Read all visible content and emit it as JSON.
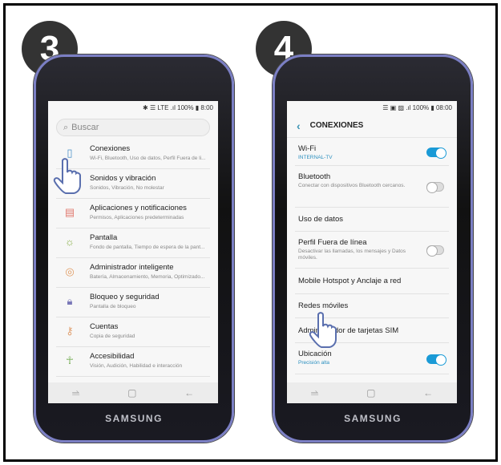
{
  "steps": [
    {
      "number": "3"
    },
    {
      "number": "4"
    }
  ],
  "brand": "SAMSUNG",
  "left": {
    "status": "✱ ☰ LTE .ıl 100% ▮ 8:00",
    "search_placeholder": "Buscar",
    "items": [
      {
        "title": "Conexiones",
        "subtitle": "Wi-Fi, Bluetooth, Uso de datos, Perfil Fuera de li...",
        "icon": "connections-icon",
        "color": "#4a90c8"
      },
      {
        "title": "Sonidos y vibración",
        "subtitle": "Sonidos, Vibración, No molestar",
        "icon": "sound-icon",
        "color": "#8a6fc8"
      },
      {
        "title": "Aplicaciones y notificaciones",
        "subtitle": "Permisos, Aplicaciones predeterminadas",
        "icon": "apps-icon",
        "color": "#e07a70"
      },
      {
        "title": "Pantalla",
        "subtitle": "Fondo de pantalla, Tiempo de espera de la pant...",
        "icon": "display-icon",
        "color": "#8ab04a"
      },
      {
        "title": "Administrador inteligente",
        "subtitle": "Batería, Almacenamiento, Memoria, Optimizado...",
        "icon": "device-care-icon",
        "color": "#e09a60"
      },
      {
        "title": "Bloqueo y seguridad",
        "subtitle": "Pantalla de bloqueo",
        "icon": "lock-icon",
        "color": "#7a78b8"
      },
      {
        "title": "Cuentas",
        "subtitle": "Copia de seguridad",
        "icon": "key-icon",
        "color": "#e0a070"
      },
      {
        "title": "Accesibilidad",
        "subtitle": "Visión, Audición, Habilidad e interacción",
        "icon": "accessibility-icon",
        "color": "#7ab05a"
      }
    ]
  },
  "right": {
    "status": "☰ ▣ ▨ .ıl 100% ▮ 08:00",
    "title": "CONEXIONES",
    "items": [
      {
        "title": "Wi-Fi",
        "subtitle": "INTERNAL-TV",
        "toggle": true
      },
      {
        "title": "Bluetooth",
        "subtitle": "Conectar con dispositivos Bluetooth cercanos.",
        "toggle": false
      },
      {
        "title": "Uso de datos"
      },
      {
        "title": "Perfil Fuera de línea",
        "subtitle": "Desactivar las llamadas, los mensajes y Datos móviles.",
        "toggle": false
      },
      {
        "title": "Mobile Hotspot y Anclaje a red"
      },
      {
        "title": "Redes móviles"
      },
      {
        "title": "Administrador de tarjetas SIM"
      },
      {
        "title": "Ubicación",
        "subtitle": "Precisión alta",
        "toggle": true
      }
    ]
  },
  "nav": {
    "recent": "⥬",
    "home": "▢",
    "back": "←"
  },
  "accent": "#1a9ad6"
}
